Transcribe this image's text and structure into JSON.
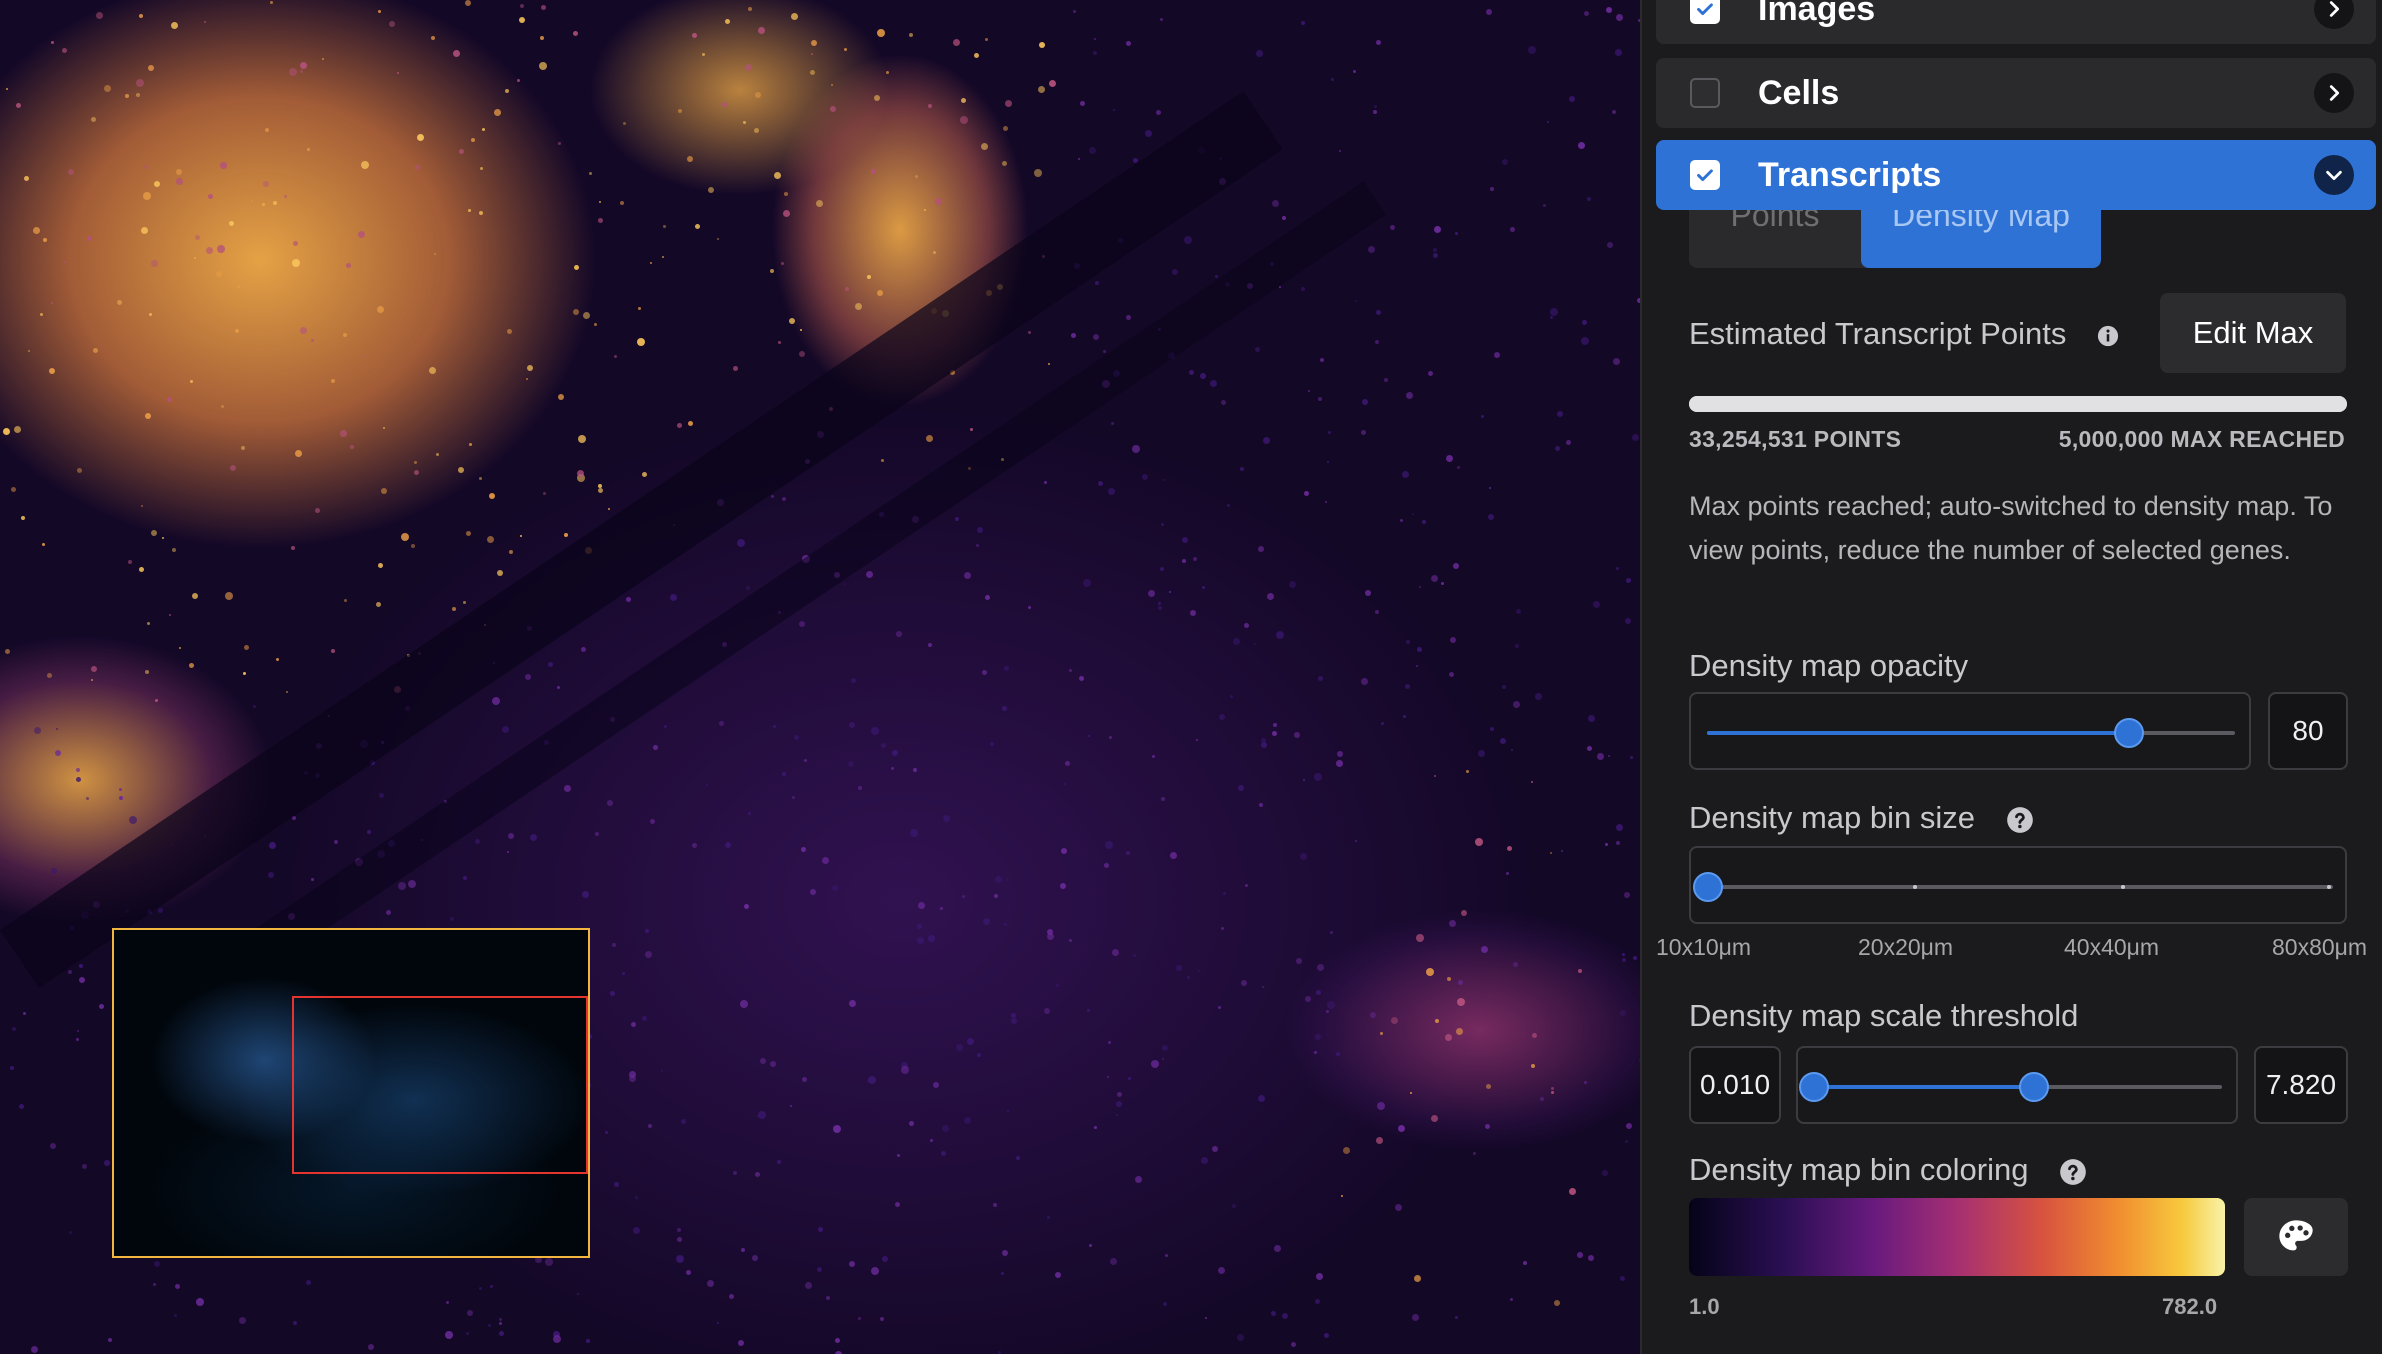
{
  "layers": [
    {
      "label": "Images",
      "checked": true
    },
    {
      "label": "Cells",
      "checked": false
    },
    {
      "label": "Transcripts",
      "checked": true
    }
  ],
  "view_tabs": {
    "points": "Points",
    "density": "Density Map",
    "selected": "density"
  },
  "estimate": {
    "label": "Estimated Transcript Points",
    "edit_max_label": "Edit Max",
    "points_text": "33,254,531 POINTS",
    "max_text": "5,000,000 MAX REACHED",
    "progress": 1.0,
    "notice": "Max points reached; auto-switched to density map. To view points, reduce the number of selected genes."
  },
  "opacity": {
    "label": "Density map opacity",
    "value": "80",
    "slider_fraction": 0.8
  },
  "bin_size": {
    "label": "Density map bin size",
    "options": [
      "10x10μm",
      "20x20μm",
      "40x40μm",
      "80x80μm"
    ],
    "selected_index": 0
  },
  "threshold": {
    "label": "Density map scale threshold",
    "min_value": "0.010",
    "max_value": "7.820",
    "low_fraction": 0.0,
    "high_fraction": 0.54
  },
  "coloring": {
    "label": "Density map bin coloring",
    "min_label": "1.0",
    "max_label": "782.0"
  },
  "colors": {
    "accent": "#2f72d6",
    "panel_bg": "#1b1b1d",
    "minimap_frame": "#f2b53d",
    "minimap_viewport": "#e3342f"
  },
  "icons": {
    "check": "check-icon",
    "chevron_right": "chevron-right-icon",
    "chevron_down": "chevron-down-icon",
    "info": "info-icon",
    "help": "help-icon",
    "palette": "palette-icon"
  }
}
